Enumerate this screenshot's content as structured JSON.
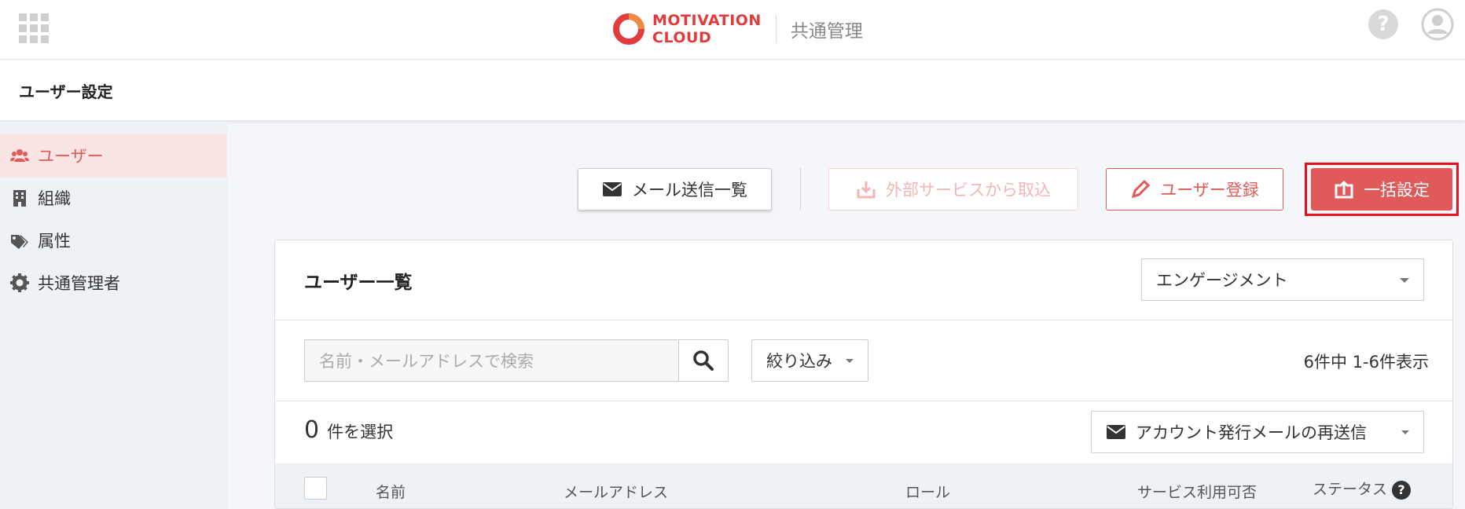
{
  "topbar": {
    "brand_line1": "MOTIVATION",
    "brand_line2": "CLOUD",
    "app_name": "共通管理",
    "help_glyph": "?"
  },
  "page": {
    "title": "ユーザー設定"
  },
  "sidebar": {
    "items": [
      {
        "label": "ユーザー",
        "icon": "users-icon",
        "active": true
      },
      {
        "label": "組織",
        "icon": "building-icon",
        "active": false
      },
      {
        "label": "属性",
        "icon": "tags-icon",
        "active": false
      },
      {
        "label": "共通管理者",
        "icon": "gear-icon",
        "active": false
      }
    ]
  },
  "actions": {
    "mail_list": "メール送信一覧",
    "import_external": "外部サービスから取込",
    "register_user": "ユーザー登録",
    "bulk_settings": "一括設定"
  },
  "user_list": {
    "title": "ユーザー一覧",
    "service_selected": "エンゲージメント",
    "search_placeholder": "名前・メールアドレスで検索",
    "filter_label": "絞り込み",
    "count_text": "6件中 1-6件表示",
    "selected_count": "0",
    "selected_label": "件を選択",
    "resend_label": "アカウント発行メールの再送信",
    "columns": {
      "name": "名前",
      "email": "メールアドレス",
      "role": "ロール",
      "service_access": "サービス利用可否",
      "status": "ステータス"
    }
  },
  "colors": {
    "brand_red": "#e05a5a",
    "highlight": "#e8101a",
    "sidebar_bg": "#eef1f6"
  }
}
